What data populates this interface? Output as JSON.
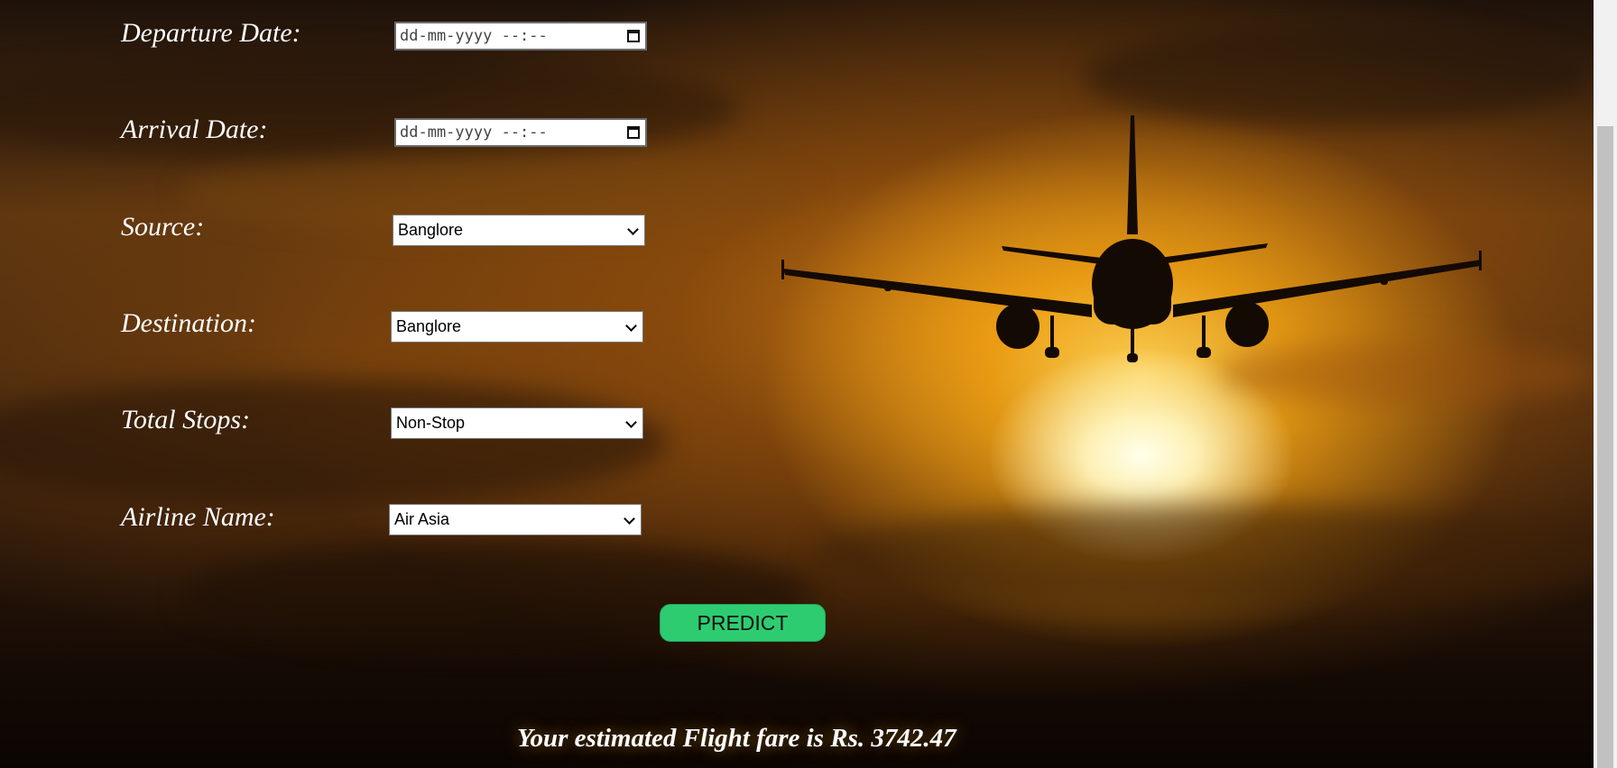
{
  "form": {
    "departure_label": "Departure Date:",
    "departure_placeholder": "dd-mm-yyyy --:--",
    "arrival_label": "Arrival Date:",
    "arrival_placeholder": "dd-mm-yyyy --:--",
    "source_label": "Source:",
    "source_value": "Banglore",
    "destination_label": "Destination:",
    "destination_value": "Banglore",
    "stops_label": "Total Stops:",
    "stops_value": "Non-Stop",
    "airline_label": "Airline Name:",
    "airline_value": "Air Asia",
    "predict_label": "PREDICT"
  },
  "result": {
    "text": "Your estimated Flight fare is Rs. 3742.47"
  },
  "icons": {
    "calendar": "calendar-icon",
    "dropdown": "chevron-down-icon"
  },
  "colors": {
    "predict_button": "#2ecc71",
    "label_text": "#ffffff"
  }
}
